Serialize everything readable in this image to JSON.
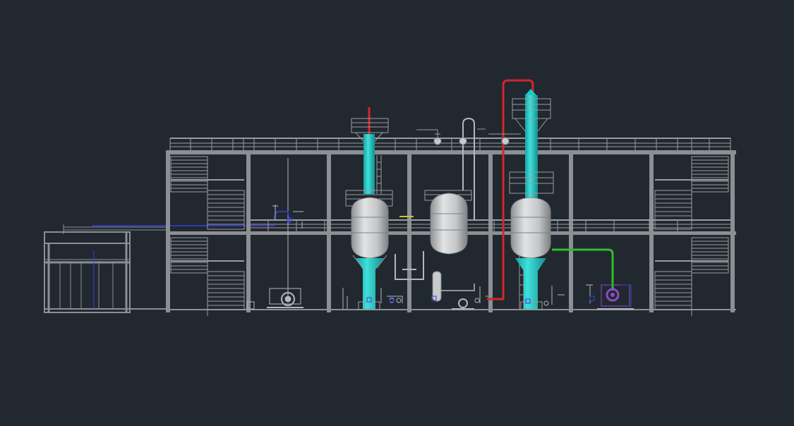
{
  "colors": {
    "background": "#212830",
    "structure": "#8c8f93",
    "structure_light": "#b4b7ba",
    "vessel": "#c8cacc",
    "vessel_dark": "#9a9da0",
    "column_cyan": "#1fc9c6",
    "pipe_red": "#d4262b",
    "pipe_green": "#2fbf2a",
    "pipe_blue": "#3b3fd6",
    "pump_purple": "#8a4cc4",
    "pipe_yellow": "#c8c23a"
  },
  "icons": {
    "reactor_1": "reactor-vessel-icon",
    "reactor_2": "reactor-vessel-icon",
    "reactor_3": "reactor-vessel-icon",
    "pump_left": "centrifugal-pump-icon",
    "pump_right": "centrifugal-pump-icon",
    "pump_center": "centrifugal-pump-icon"
  }
}
